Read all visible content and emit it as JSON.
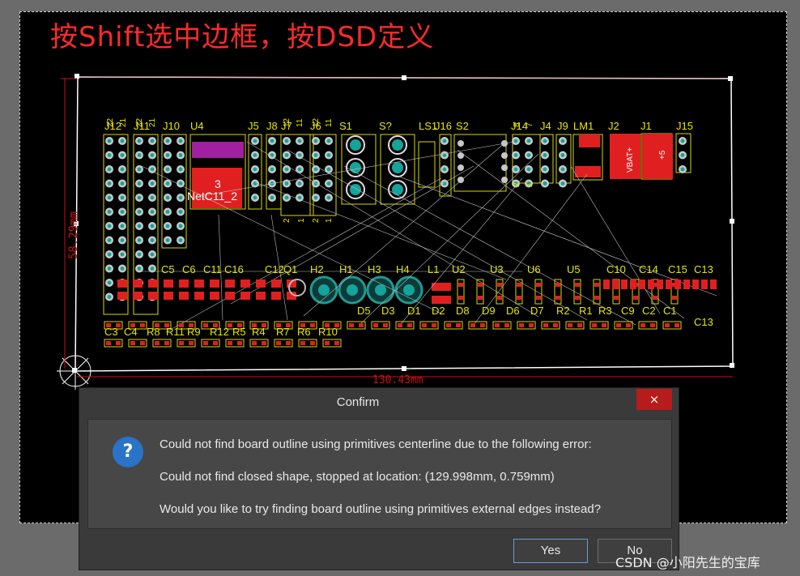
{
  "annotation": {
    "text": "按Shift选中边框，按DSD定义"
  },
  "pcb": {
    "dimension_vertical": "58.29mm",
    "dimension_horizontal": "130.43mm",
    "net_label": "NetC11_2",
    "pad_number": "3",
    "top_designators": [
      "J12",
      "J11",
      "J10",
      "U4",
      "J5",
      "J8",
      "J7",
      "J6",
      "S1",
      "S?",
      "LS1",
      "J16",
      "S2",
      "J14",
      "J4",
      "J9",
      "LM1",
      "J2",
      "J1",
      "J15"
    ],
    "mid_designators": [
      "C5",
      "C6",
      "C11",
      "C16",
      "C12",
      "Q1",
      "H2",
      "H1",
      "H3",
      "H4",
      "L1",
      "U2",
      "U3",
      "U6",
      "U5",
      "C10",
      "C14",
      "C15",
      "C13"
    ],
    "lower_designators": [
      "D5",
      "D3",
      "D1",
      "D2",
      "D8",
      "D9",
      "D6",
      "D7",
      "R2",
      "R1",
      "R3",
      "C9",
      "C2",
      "C1"
    ],
    "bottom_designators": [
      "C3",
      "C4",
      "R8",
      "R11",
      "R9",
      "R12",
      "R5",
      "R4",
      "R7",
      "R6",
      "R10"
    ],
    "small_labels": [
      "22",
      "21",
      "22",
      "21",
      "12",
      "11",
      "12",
      "11",
      "8",
      "7",
      "2",
      "1",
      "2",
      "1",
      "2",
      "1",
      "2",
      "1"
    ],
    "battery_label": "VBAT+",
    "plus_label": "+5"
  },
  "dialog": {
    "title": "Confirm",
    "close_label": "×",
    "icon": "question-icon",
    "line1": "Could not find board outline using primitives centerline due to the following error:",
    "line2": "Could not find closed shape, stopped at location: (129.998mm, 0.759mm)",
    "line3": "Would you like to try finding board outline using primitives external edges instead?",
    "yes_label": "Yes",
    "no_label": "No"
  },
  "watermark": {
    "text": "CSDN @小阳先生的宝库"
  },
  "colors": {
    "annotation": "#ff2a2a",
    "silk": "#ffff00",
    "pad": "#e02020",
    "via": "#14a49c",
    "close": "#b71c1c",
    "accent": "#2a73c8"
  }
}
